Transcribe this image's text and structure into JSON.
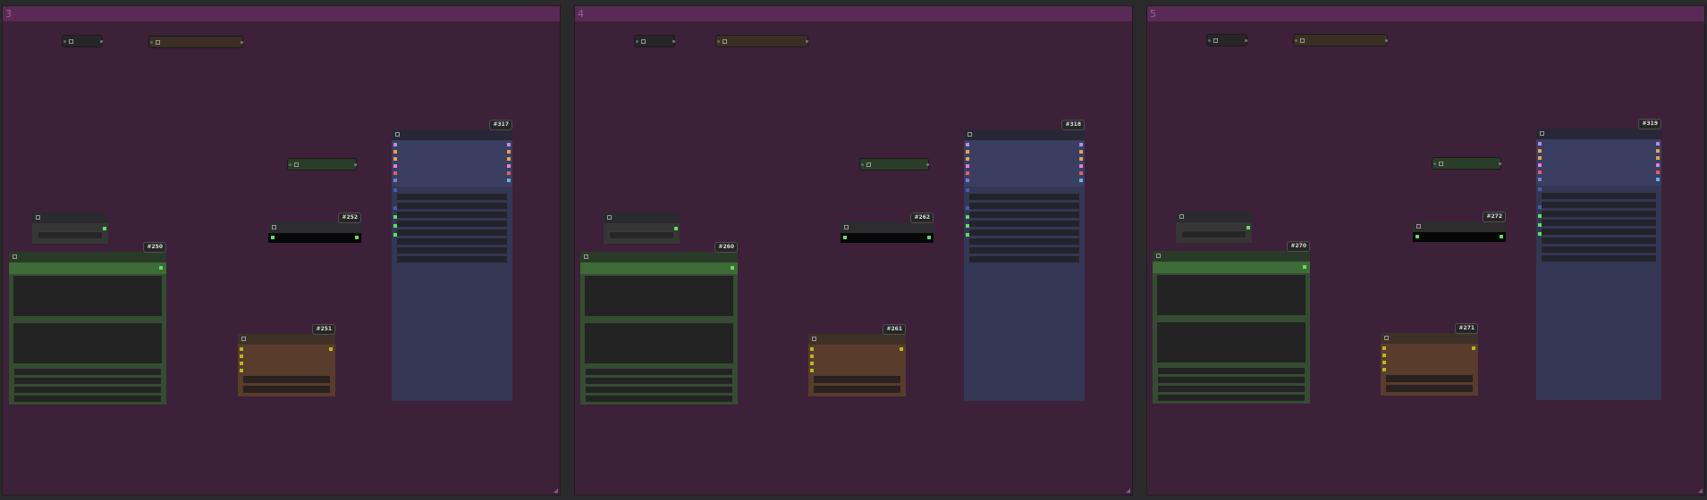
{
  "canvas": {
    "background": "#2a2a2c",
    "colors": {
      "group_body": "#3c2139",
      "group_header": "#5a2a56",
      "sampler": "#343754",
      "prompt_node": "#344d31",
      "brown_node": "#593c2c",
      "socket_green": "#5de05d",
      "socket_yellow": "#b8b81e"
    }
  },
  "groups": [
    {
      "title": "3",
      "nodes": {
        "sampler_badge": "#317",
        "black_badge": "#252",
        "prompt_badge": "#250",
        "brown_badge": "#251"
      }
    },
    {
      "title": "4",
      "nodes": {
        "sampler_badge": "#318",
        "black_badge": "#262",
        "prompt_badge": "#260",
        "brown_badge": "#261"
      }
    },
    {
      "title": "5",
      "nodes": {
        "sampler_badge": "#319",
        "black_badge": "#272",
        "prompt_badge": "#270",
        "brown_badge": "#271"
      }
    }
  ]
}
